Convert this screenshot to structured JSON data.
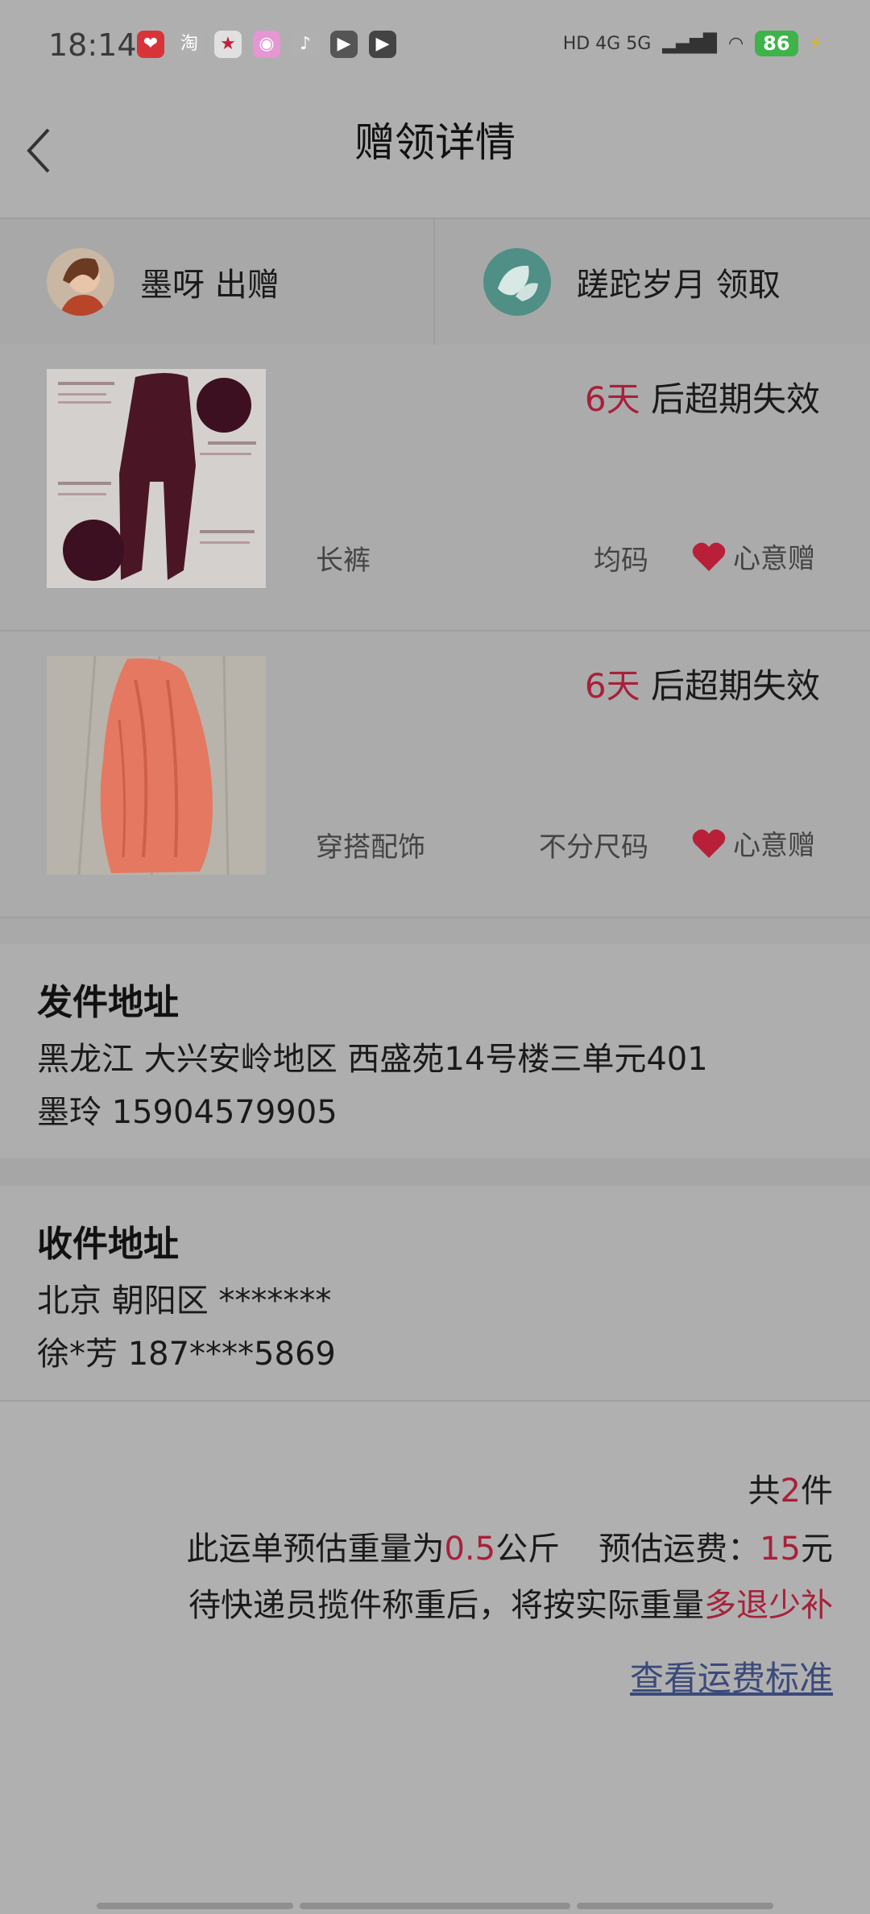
{
  "status_bar": {
    "time": "18:14",
    "app_icons": [
      {
        "name": "pinduoduo-icon",
        "glyph": "❤",
        "color": "#d9333a"
      },
      {
        "name": "taobao-icon",
        "glyph": "淘",
        "color": "#b0b0b0"
      },
      {
        "name": "star-app-icon",
        "glyph": "★",
        "color": "#e0e0e0"
      },
      {
        "name": "camera-app-icon",
        "glyph": "◉",
        "color": "#e596d3"
      },
      {
        "name": "tiktok-icon",
        "glyph": "♪",
        "color": "#b0b0b0"
      },
      {
        "name": "play-app-icon",
        "glyph": "▶",
        "color": "#555"
      },
      {
        "name": "video-app-icon",
        "glyph": "▶",
        "color": "#444"
      }
    ],
    "network": "HD 4G 5G",
    "battery": "86"
  },
  "header": {
    "title": "赠领详情"
  },
  "parties": {
    "giver": {
      "name": "墨呀",
      "action": "出赠"
    },
    "receiver": {
      "name": "蹉跎岁月",
      "action": "领取"
    }
  },
  "items": [
    {
      "expiry_days": "6天",
      "expiry_suffix": " 后超期失效",
      "category": "长裤",
      "size": "均码",
      "gift_type": "心意赠"
    },
    {
      "expiry_days": "6天",
      "expiry_suffix": " 后超期失效",
      "category": "穿搭配饰",
      "size": "不分尺码",
      "gift_type": "心意赠"
    }
  ],
  "sender_address": {
    "title": "发件地址",
    "line1": "黑龙江 大兴安岭地区 西盛苑14号楼三单元401",
    "line2": "墨玲 15904579905"
  },
  "receiver_address": {
    "title": "收件地址",
    "line1": "北京 朝阳区 *******",
    "line2": "徐*芳 187****5869"
  },
  "summary": {
    "count_prefix": "共",
    "count": "2",
    "count_suffix": "件",
    "weight_prefix": "此运单预估重量为",
    "weight": "0.5",
    "weight_unit": "公斤",
    "fee_label": "预估运费：",
    "fee": "15",
    "fee_unit": "元",
    "note_prefix": "待快递员揽件称重后，将按实际重量",
    "note_highlight": "多退少补"
  },
  "link": {
    "fee_standard": "查看运费标准"
  },
  "colors": {
    "accent_red": "#a8203a",
    "link_blue": "#3b4a7a"
  }
}
